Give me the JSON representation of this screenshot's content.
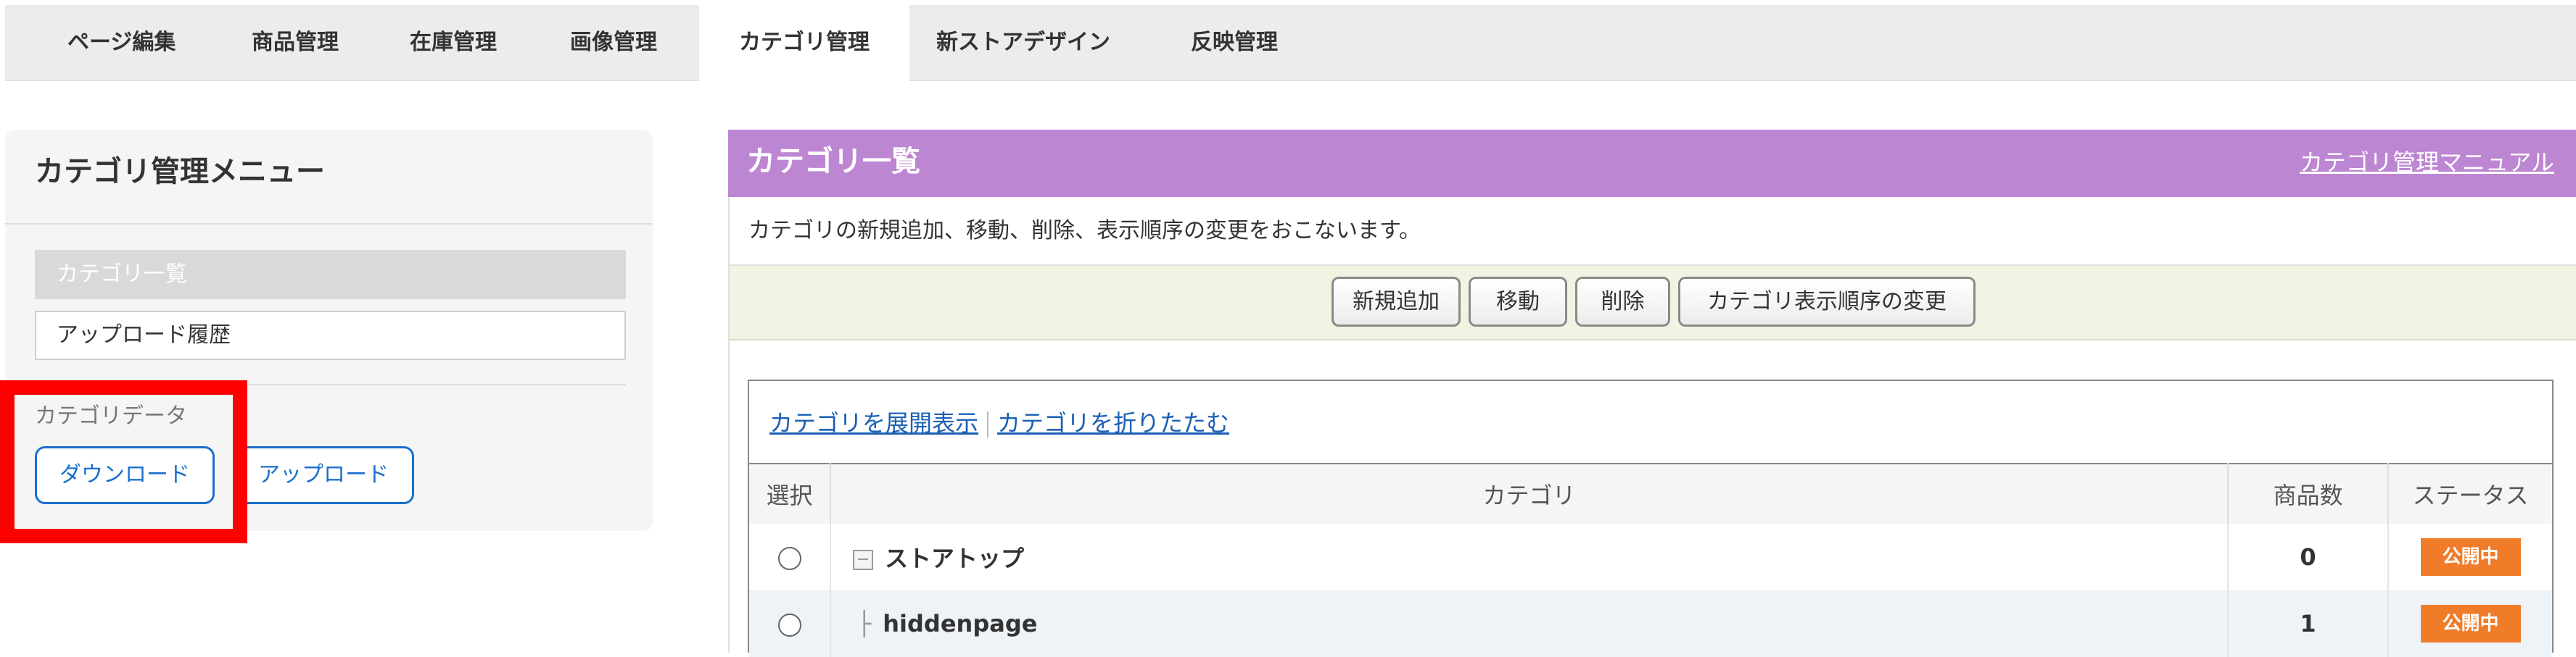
{
  "tabs": [
    {
      "label": "ページ編集"
    },
    {
      "label": "商品管理"
    },
    {
      "label": "在庫管理"
    },
    {
      "label": "画像管理"
    },
    {
      "label": "カテゴリ管理",
      "active": true
    },
    {
      "label": "新ストアデザイン"
    },
    {
      "label": "反映管理"
    }
  ],
  "sidebar": {
    "title": "カテゴリ管理メニュー",
    "items": [
      {
        "label": "カテゴリ一覧",
        "active": true
      },
      {
        "label": "アップロード履歴"
      }
    ],
    "data_label": "カテゴリデータ",
    "download_label": "ダウンロード",
    "upload_label": "アップロード"
  },
  "main": {
    "title": "カテゴリ一覧",
    "manual_link": "カテゴリ管理マニュアル",
    "description": "カテゴリの新規追加、移動、削除、表示順序の変更をおこないます。",
    "actions": {
      "add": "新規追加",
      "move": "移動",
      "delete": "削除",
      "reorder": "カテゴリ表示順序の変更"
    },
    "tree_links": {
      "expand": "カテゴリを展開表示",
      "collapse": "カテゴリを折りたたむ"
    },
    "table": {
      "headers": {
        "select": "選択",
        "category": "カテゴリ",
        "count": "商品数",
        "status": "ステータス"
      },
      "rows": [
        {
          "name": "ストアトップ",
          "count": "0",
          "status": "公開中"
        },
        {
          "name": "hiddenpage",
          "count": "1",
          "status": "公開中"
        }
      ]
    }
  },
  "colors": {
    "header_purple": "#bd86d2",
    "link_blue": "#1a5fb4",
    "status_orange": "#f07c2a",
    "highlight_red": "#ff0000"
  }
}
